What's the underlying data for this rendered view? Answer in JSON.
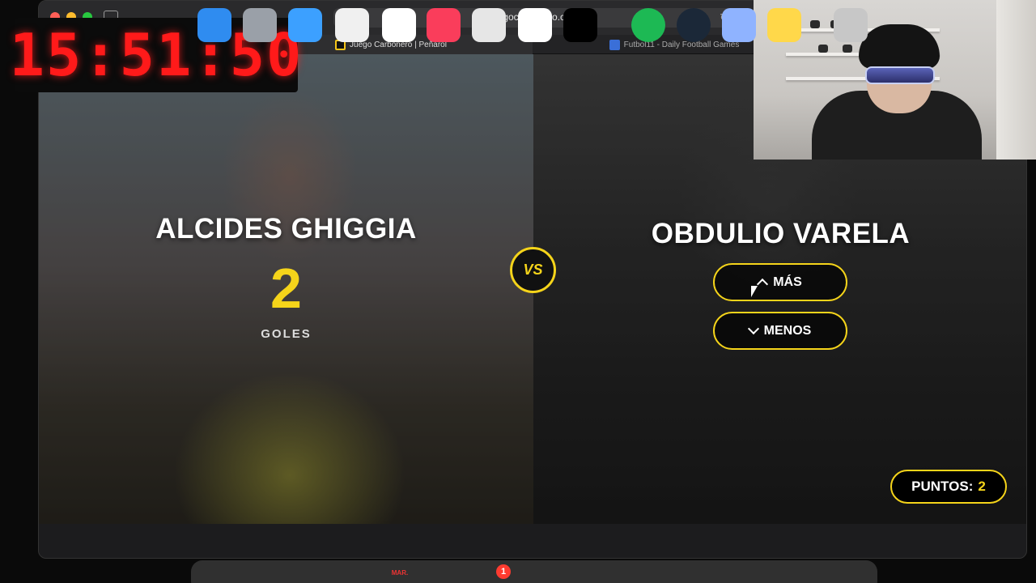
{
  "browser": {
    "url": "juegocarbonero.com",
    "tabs": [
      {
        "label": "Juego Carbonero | Peñarol",
        "favicon": "penarol-favicon-icon",
        "active": true
      },
      {
        "label": "Futbol11 - Daily Football Games",
        "favicon": "futbol11-favicon-icon",
        "active": false
      }
    ]
  },
  "game": {
    "left_player": {
      "name": "ALCIDES GHIGGIA",
      "stat_value": "2",
      "stat_label": "GOLES"
    },
    "vs_label": "VS",
    "right_player": {
      "name": "OBDULIO VARELA"
    },
    "buttons": {
      "more": "MÁS",
      "less": "MENOS"
    },
    "score": {
      "label": "PUNTOS:",
      "value": "2"
    }
  },
  "overlay": {
    "clock": "15:51:50"
  },
  "dock": {
    "calendar_month": "MAR.",
    "notification_badge": "1",
    "icons": [
      "finder-icon",
      "launchpad-icon",
      "safari-icon",
      "photos-icon",
      "calendar-icon",
      "music-icon",
      "chatgpt-icon",
      "slack-icon",
      "x-icon",
      "spotify-icon",
      "steam-icon",
      "preview-icon",
      "notes-icon",
      "trash-icon"
    ]
  },
  "colors": {
    "accent": "#f5d41a",
    "clock_red": "#ff1a1a",
    "button_border": "#f5d41a"
  }
}
